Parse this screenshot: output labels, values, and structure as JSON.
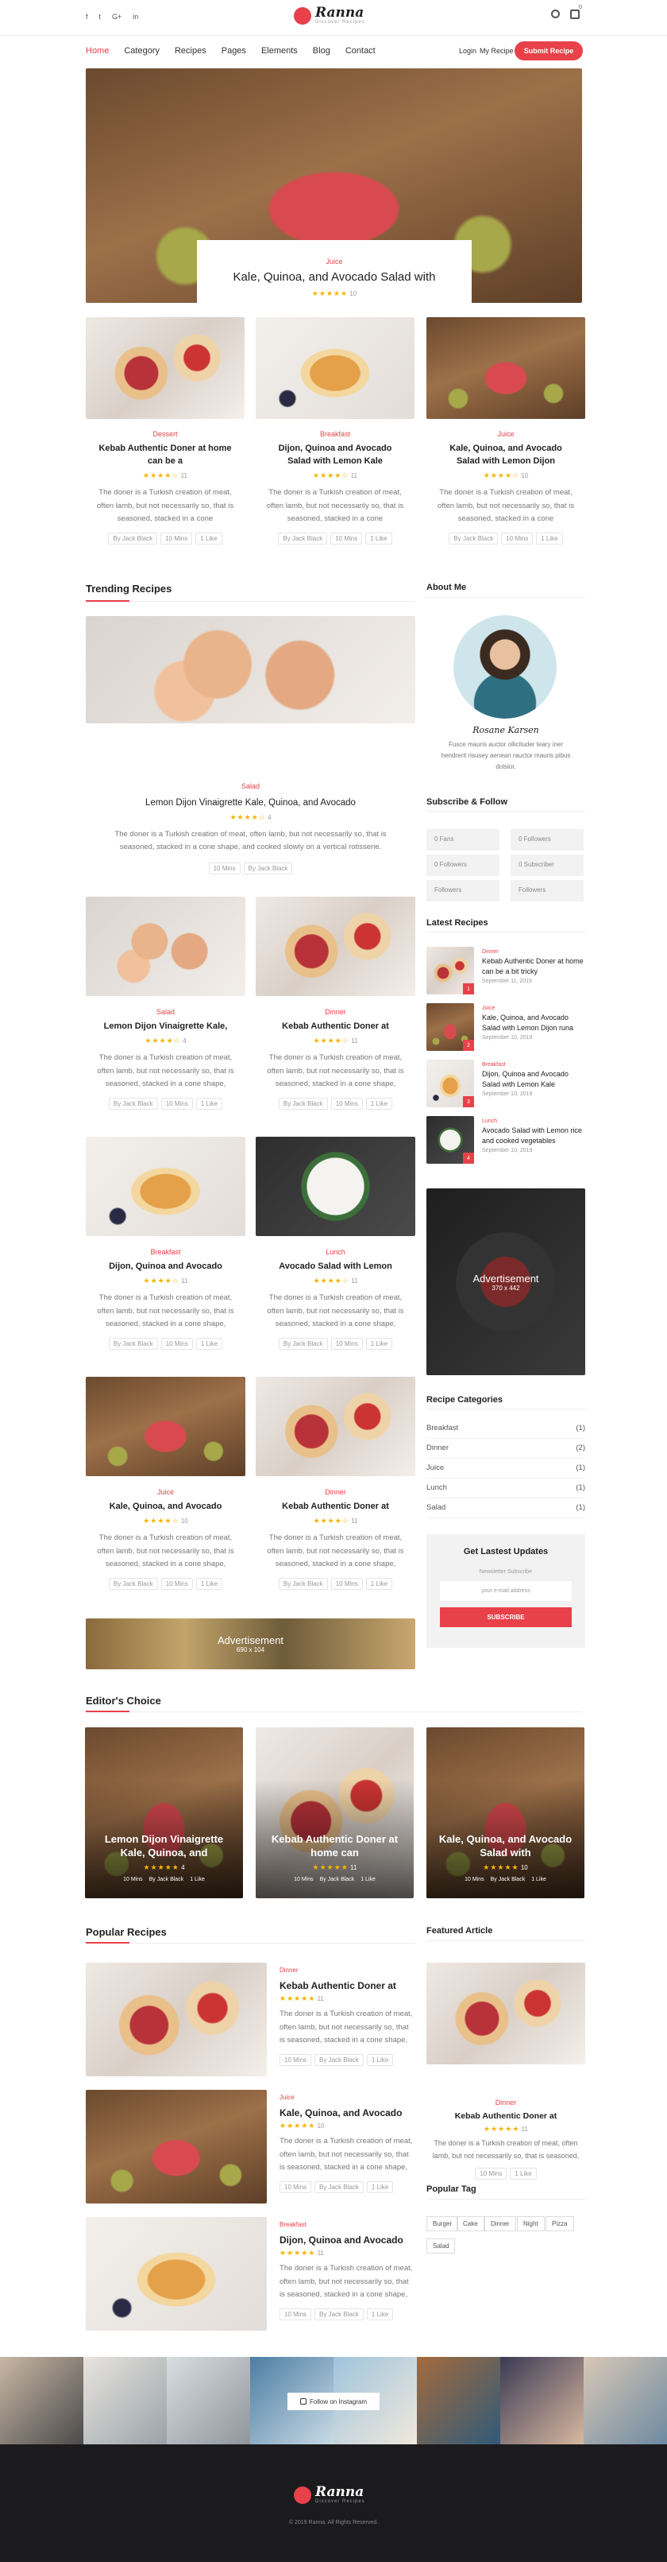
{
  "social": [
    "f",
    "t",
    "G+",
    "in"
  ],
  "brand": {
    "name": "Ranna",
    "tagline": "Discover Recipes"
  },
  "cart_count": "0",
  "nav": [
    "Home",
    "Category",
    "Recipes",
    "Pages",
    "Elements",
    "Blog",
    "Contact"
  ],
  "login": "Login",
  "my_recipe": "My Recipe",
  "submit": "Submit Recipe",
  "hero": {
    "cat": "Juice",
    "title": "Kale, Quinoa, and Avocado Salad with",
    "rating": "10"
  },
  "top_cards": [
    {
      "cat": "Dessert",
      "title": "Kebab Authentic Doner at home can be a",
      "rating": "11",
      "desc": "The doner is a Turkish creation of meat, often lamb, but not necessarily so, that is seasoned, stacked in a cone",
      "author": "By Jack Black",
      "time": "10 Mins",
      "likes": "1 Like"
    },
    {
      "cat": "Breakfast",
      "title": "Dijon, Quinoa and Avocado Salad with Lemon Kale",
      "rating": "11",
      "desc": "The doner is a Turkish creation of meat, often lamb, but not necessarily so, that is seasoned, stacked in a cone",
      "author": "By Jack Black",
      "time": "10 Mins",
      "likes": "1 Like"
    },
    {
      "cat": "Juice",
      "title": "Kale, Quinoa, and Avocado Salad with Lemon Dijon",
      "rating": "10",
      "desc": "The doner is a Turkish creation of meat, often lamb, but not necessarily so, that is seasoned, stacked in a cone",
      "author": "By Jack Black",
      "time": "10 Mins",
      "likes": "1 Like"
    }
  ],
  "trending": {
    "heading": "Trending Recipes",
    "feature": {
      "cat": "Salad",
      "title": "Lemon Dijon Vinaigrette Kale, Quinoa, and Avocado",
      "rating": "4",
      "desc": "The doner is a Turkish creation of meat, often lamb, but not necessarily so, that is seasoned, stacked in a cone shape, and cooked slowly on a vertical rotisserie.",
      "time": "10 Mins",
      "author": "By Jack Black"
    },
    "grid": [
      {
        "cat": "Salad",
        "title": "Lemon Dijon Vinaigrette Kale,",
        "rating": "4",
        "desc": "The doner is a Turkish creation of meat, often lamb, but not necessarily so, that is seasoned, stacked in a cone shape,",
        "author": "By Jack Black",
        "time": "10 Mins",
        "likes": "1 Like"
      },
      {
        "cat": "Dinner",
        "title": "Kebab Authentic Doner at",
        "rating": "11",
        "desc": "The doner is a Turkish creation of meat, often lamb, but not necessarily so, that is seasoned, stacked in a cone shape,",
        "author": "By Jack Black",
        "time": "10 Mins",
        "likes": "1 Like"
      },
      {
        "cat": "Breakfast",
        "title": "Dijon, Quinoa and Avocado",
        "rating": "11",
        "desc": "The doner is a Turkish creation of meat, often lamb, but not necessarily so, that is seasoned, stacked in a cone shape,",
        "author": "By Jack Black",
        "time": "10 Mins",
        "likes": "1 Like"
      },
      {
        "cat": "Lunch",
        "title": "Avocado Salad with Lemon",
        "rating": "11",
        "desc": "The doner is a Turkish creation of meat, often lamb, but not necessarily so, that is seasoned, stacked in a cone shape,",
        "author": "By Jack Black",
        "time": "10 Mins",
        "likes": "1 Like"
      },
      {
        "cat": "Juice",
        "title": "Kale, Quinoa, and Avocado",
        "rating": "10",
        "desc": "The doner is a Turkish creation of meat, often lamb, but not necessarily so, that is seasoned, stacked in a cone shape,",
        "author": "By Jack Black",
        "time": "10 Mins",
        "likes": "1 Like"
      },
      {
        "cat": "Dinner",
        "title": "Kebab Authentic Doner at",
        "rating": "11",
        "desc": "The doner is a Turkish creation of meat, often lamb, but not necessarily so, that is seasoned, stacked in a cone shape,",
        "author": "By Jack Black",
        "time": "10 Mins",
        "likes": "1 Like"
      }
    ],
    "ad": {
      "label": "Advertisement",
      "size": "690 x 104"
    }
  },
  "about": {
    "heading": "About Me",
    "signature": "Rosane Karsen",
    "text": "Fusce mauris auctor ollicituder teary iner hendrerit risusey aenean rauctor mauris pibus dolsior."
  },
  "follow": {
    "heading": "Subscribe & Follow",
    "items": [
      "0 Fans",
      "0 Followers",
      "0 Followers",
      "0 Subscriber",
      "Followers",
      "Followers"
    ]
  },
  "latest": {
    "heading": "Latest Recipes",
    "items": [
      {
        "cat": "Dinner",
        "title": "Kebab Authentic Doner at home can be a bit tricky",
        "date": "September 11, 2019"
      },
      {
        "cat": "Juice",
        "title": "Kale, Quinoa, and Avocado Salad with Lemon Dijon runa",
        "date": "September 10, 2019"
      },
      {
        "cat": "Breakfast",
        "title": "Dijon, Quinoa and Avocado Salad with Lemon Kale",
        "date": "September 10, 2019"
      },
      {
        "cat": "Lunch",
        "title": "Avocado Salad with Lemon rice and cooked vegetables",
        "date": "September 10, 2019"
      }
    ]
  },
  "side_ad": {
    "label": "Advertisement",
    "size": "370 x 442"
  },
  "categories": {
    "heading": "Recipe Categories",
    "items": [
      {
        "name": "Breakfast",
        "count": "(1)"
      },
      {
        "name": "Dinner",
        "count": "(2)"
      },
      {
        "name": "Juice",
        "count": "(1)"
      },
      {
        "name": "Lunch",
        "count": "(1)"
      },
      {
        "name": "Salad",
        "count": "(1)"
      }
    ]
  },
  "newsletter": {
    "heading": "Get Lastest Updates",
    "sub": "Newsletter Subscribe",
    "placeholder": "your e-mail address",
    "button": "SUBSCRIBE"
  },
  "editors": {
    "heading": "Editor's Choice",
    "items": [
      {
        "title": "Lemon Dijon Vinaigrette Kale, Quinoa, and",
        "rating": "4",
        "time": "10 Mins",
        "author": "By Jack Black",
        "likes": "1 Like"
      },
      {
        "title": "Kebab Authentic Doner at home can",
        "rating": "11",
        "time": "10 Mins",
        "author": "By Jack Black",
        "likes": "1 Like"
      },
      {
        "title": "Kale, Quinoa, and Avocado Salad with",
        "rating": "10",
        "time": "10 Mins",
        "author": "By Jack Black",
        "likes": "1 Like"
      }
    ]
  },
  "popular": {
    "heading": "Popular Recipes",
    "items": [
      {
        "cat": "Dinner",
        "title": "Kebab Authentic Doner at",
        "rating": "11",
        "desc": "The doner is a Turkish creation of meat, often lamb, but not necessarily so, that is seasoned, stacked in a cone shape,",
        "time": "10 Mins",
        "author": "By Jack Black",
        "likes": "1 Like"
      },
      {
        "cat": "Juice",
        "title": "Kale, Quinoa, and Avocado",
        "rating": "10",
        "desc": "The doner is a Turkish creation of meat, often lamb, but not necessarily so, that is seasoned, stacked in a cone shape,",
        "time": "10 Mins",
        "author": "By Jack Black",
        "likes": "1 Like"
      },
      {
        "cat": "Breakfast",
        "title": "Dijon, Quinoa and Avocado",
        "rating": "11",
        "desc": "The doner is a Turkish creation of meat, often lamb, but not necessarily so, that is seasoned, stacked in a cone shape,",
        "time": "10 Mins",
        "author": "By Jack Black",
        "likes": "1 Like"
      }
    ]
  },
  "featured": {
    "heading": "Featured Article",
    "cat": "Dinner",
    "title": "Kebab Authentic Doner at",
    "rating": "11",
    "desc": "The doner is a Turkish creation of meat, often lamb, but not necessarily so, that is seasoned,",
    "time": "10 Mins",
    "likes": "1 Like"
  },
  "tags": {
    "heading": "Popular Tag",
    "items": [
      "Burger",
      "Cake",
      "Dinner",
      "Night",
      "Pizza",
      "Salad"
    ]
  },
  "instagram": "Follow on Instagram",
  "copyright": "© 2019 Ranna. All Rights Reserved."
}
